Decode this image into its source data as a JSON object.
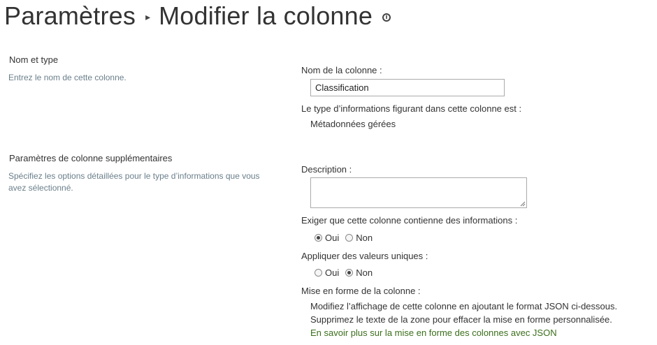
{
  "header": {
    "breadcrumb_root": "Paramètres",
    "page_title": "Modifier la colonne"
  },
  "section_name_type": {
    "title": "Nom et type",
    "description": "Entrez le nom de cette colonne."
  },
  "section_additional": {
    "title": "Paramètres de colonne supplémentaires",
    "description_line1": "Spécifiez les options détaillées pour le type d’informations que vous",
    "description_line2": "avez sélectionné."
  },
  "column_name": {
    "label": "Nom de la colonne :",
    "value": "Classification"
  },
  "column_type": {
    "label": "Le type d’informations figurant dans cette colonne est :",
    "value": "Métadonnées gérées"
  },
  "description_field": {
    "label": "Description :",
    "value": ""
  },
  "required": {
    "label": "Exiger que cette colonne contienne des informations :",
    "options": [
      "Oui",
      "Non"
    ],
    "selected": "Oui"
  },
  "unique": {
    "label": "Appliquer des valeurs uniques :",
    "options": [
      "Oui",
      "Non"
    ],
    "selected": "Non"
  },
  "formatting": {
    "label": "Mise en forme de la colonne :",
    "line1": "Modifiez l’affichage de cette colonne en ajoutant le format JSON ci-dessous.",
    "line2": "Supprimez le texte de la zone pour effacer la mise en forme personnalisée.",
    "link": "En savoir plus sur la mise en forme des colonnes avec JSON"
  },
  "icons": {
    "info": "info-icon",
    "breadcrumb_separator": "triangle-right-icon",
    "resize": "resize-grip-icon"
  },
  "colors": {
    "link": "#3b6e1b",
    "description_text": "#6a7f8b"
  }
}
